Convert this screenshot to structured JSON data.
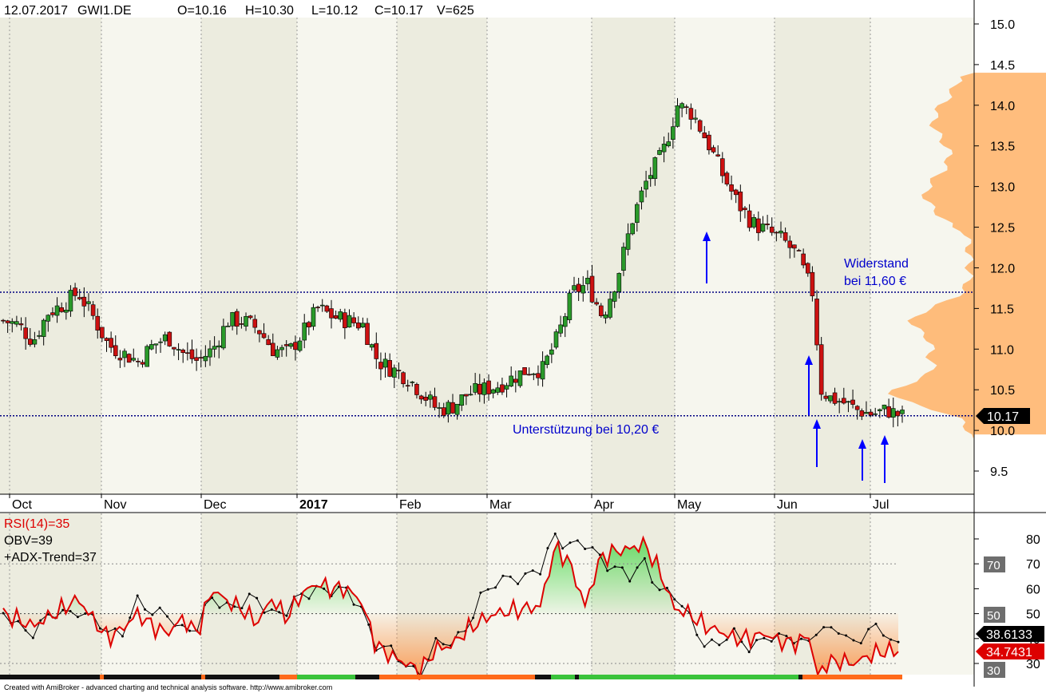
{
  "header": {
    "date": "12.07.2017",
    "symbol": "GWI1.DE",
    "open": "O=10.16",
    "high": "H=10.30",
    "low": "L=10.12",
    "close": "C=10.17",
    "volume": "V=625"
  },
  "last_price_badge": "10.17",
  "annotations": {
    "resistance_line1": "Widerstand",
    "resistance_line2": "bei 11,60 €",
    "support": "Unterstützung bei 10,20 €"
  },
  "indicators": {
    "rsi_label": "RSI(14)=35",
    "obv_label": "OBV=39",
    "adx_label": "+ADX-Trend=37",
    "badge_obv": "38.6133",
    "badge_rsi": "34.7431",
    "level_70": "70",
    "level_50": "50",
    "level_30": "30"
  },
  "footer": "Created with AmiBroker - advanced charting and technical analysis software. http://www.amibroker.com",
  "colors": {
    "up_candle": "#2a9a2a",
    "down_candle": "#cc1111",
    "rsi_line": "#dd0000",
    "obv_line": "#000000",
    "volume_profile": "#ffb266",
    "guide_line": "#000080",
    "annotation": "#0000cc"
  },
  "chart_data": [
    {
      "type": "candlestick",
      "y_axis_ticks": [
        "15.0",
        "14.5",
        "14.0",
        "13.5",
        "13.0",
        "12.5",
        "12.0",
        "11.5",
        "11.0",
        "10.5",
        "10.0",
        "9.5"
      ],
      "ylim": [
        9.2,
        15.3
      ],
      "x_tick_labels": [
        "Oct",
        "Nov",
        "Dec",
        "2017",
        "Feb",
        "Mar",
        "Apr",
        "May",
        "Jun",
        "Jul"
      ],
      "reference_lines": [
        11.7,
        10.18
      ],
      "close_path": [
        [
          0,
          11.35
        ],
        [
          5,
          11.3
        ],
        [
          10,
          11.1
        ],
        [
          15,
          11.45
        ],
        [
          20,
          11.55
        ],
        [
          25,
          11.7
        ],
        [
          30,
          11.4
        ],
        [
          35,
          11.05
        ],
        [
          40,
          10.95
        ],
        [
          45,
          10.85
        ],
        [
          50,
          11.05
        ],
        [
          55,
          11.15
        ],
        [
          60,
          10.95
        ],
        [
          65,
          10.85
        ],
        [
          70,
          11.0
        ],
        [
          75,
          11.35
        ],
        [
          80,
          11.35
        ],
        [
          85,
          11.25
        ],
        [
          90,
          11.0
        ],
        [
          95,
          10.95
        ],
        [
          100,
          11.2
        ],
        [
          105,
          11.5
        ],
        [
          110,
          11.4
        ],
        [
          115,
          11.35
        ],
        [
          120,
          11.3
        ],
        [
          125,
          10.85
        ],
        [
          130,
          10.75
        ],
        [
          135,
          10.65
        ],
        [
          140,
          10.45
        ],
        [
          145,
          10.25
        ],
        [
          150,
          10.3
        ],
        [
          155,
          10.45
        ],
        [
          160,
          10.5
        ],
        [
          165,
          10.55
        ],
        [
          170,
          10.65
        ],
        [
          175,
          10.75
        ],
        [
          180,
          10.75
        ],
        [
          185,
          11.15
        ],
        [
          190,
          11.7
        ],
        [
          195,
          11.8
        ],
        [
          200,
          11.4
        ],
        [
          205,
          11.9
        ],
        [
          210,
          12.6
        ],
        [
          215,
          13.1
        ],
        [
          220,
          13.4
        ],
        [
          225,
          14.0
        ],
        [
          230,
          13.9
        ],
        [
          235,
          13.55
        ],
        [
          240,
          13.15
        ],
        [
          245,
          12.8
        ],
        [
          250,
          12.55
        ],
        [
          255,
          12.45
        ],
        [
          260,
          12.35
        ],
        [
          265,
          12.15
        ],
        [
          270,
          11.7
        ],
        [
          273,
          10.5
        ],
        [
          276,
          10.4
        ],
        [
          280,
          10.35
        ],
        [
          285,
          10.25
        ],
        [
          290,
          10.2
        ],
        [
          295,
          10.25
        ],
        [
          300,
          10.17
        ]
      ],
      "annotations": [
        "Widerstand bei 11,60 €",
        "Unterstützung bei 10,20 €"
      ]
    },
    {
      "type": "line",
      "y_axis_ticks": [
        "80",
        "70",
        "60",
        "50",
        "40",
        "30"
      ],
      "ylim": [
        23,
        88
      ],
      "reference_levels": [
        70,
        50,
        30
      ],
      "series": [
        {
          "name": "RSI(14)",
          "values_path": [
            [
              0,
              50
            ],
            [
              10,
              45
            ],
            [
              20,
              52
            ],
            [
              25,
              56
            ],
            [
              30,
              48
            ],
            [
              35,
              40
            ],
            [
              40,
              44
            ],
            [
              45,
              50
            ],
            [
              50,
              45
            ],
            [
              55,
              42
            ],
            [
              60,
              48
            ],
            [
              65,
              42
            ],
            [
              70,
              60
            ],
            [
              75,
              55
            ],
            [
              80,
              52
            ],
            [
              85,
              46
            ],
            [
              90,
              56
            ],
            [
              95,
              48
            ],
            [
              100,
              58
            ],
            [
              105,
              62
            ],
            [
              110,
              60
            ],
            [
              115,
              60
            ],
            [
              120,
              55
            ],
            [
              125,
              37
            ],
            [
              130,
              33
            ],
            [
              135,
              30
            ],
            [
              140,
              27
            ],
            [
              145,
              36
            ],
            [
              150,
              37
            ],
            [
              155,
              43
            ],
            [
              160,
              47
            ],
            [
              165,
              50
            ],
            [
              170,
              51
            ],
            [
              175,
              52
            ],
            [
              180,
              53
            ],
            [
              185,
              77
            ],
            [
              190,
              70
            ],
            [
              195,
              53
            ],
            [
              200,
              72
            ],
            [
              205,
              75
            ],
            [
              210,
              76
            ],
            [
              215,
              78
            ],
            [
              220,
              67
            ],
            [
              225,
              52
            ],
            [
              230,
              50
            ],
            [
              235,
              45
            ],
            [
              240,
              43
            ],
            [
              245,
              40
            ],
            [
              250,
              40
            ],
            [
              255,
              42
            ],
            [
              260,
              39
            ],
            [
              265,
              38
            ],
            [
              270,
              41
            ],
            [
              273,
              25
            ],
            [
              276,
              30
            ],
            [
              280,
              31
            ],
            [
              285,
              30
            ],
            [
              290,
              33
            ],
            [
              295,
              35
            ],
            [
              300,
              34.74
            ]
          ]
        },
        {
          "name": "OBV",
          "values_path": [
            [
              0,
              48
            ],
            [
              10,
              44
            ],
            [
              20,
              50
            ],
            [
              25,
              53
            ],
            [
              30,
              47
            ],
            [
              35,
              41
            ],
            [
              40,
              45
            ],
            [
              45,
              55
            ],
            [
              50,
              48
            ],
            [
              55,
              52
            ],
            [
              60,
              44
            ],
            [
              65,
              42
            ],
            [
              70,
              58
            ],
            [
              75,
              54
            ],
            [
              80,
              52
            ],
            [
              85,
              56
            ],
            [
              90,
              52
            ],
            [
              95,
              50
            ],
            [
              100,
              56
            ],
            [
              105,
              62
            ],
            [
              110,
              59
            ],
            [
              115,
              57
            ],
            [
              120,
              54
            ],
            [
              125,
              38
            ],
            [
              130,
              33
            ],
            [
              135,
              30
            ],
            [
              140,
              28
            ],
            [
              145,
              36
            ],
            [
              150,
              38
            ],
            [
              155,
              46
            ],
            [
              160,
              55
            ],
            [
              165,
              61
            ],
            [
              170,
              67
            ],
            [
              175,
              64
            ],
            [
              180,
              66
            ],
            [
              185,
              83
            ],
            [
              190,
              78
            ],
            [
              195,
              76
            ],
            [
              200,
              73
            ],
            [
              205,
              70
            ],
            [
              210,
              63
            ],
            [
              215,
              70
            ],
            [
              220,
              62
            ],
            [
              225,
              56
            ],
            [
              230,
              47
            ],
            [
              235,
              40
            ],
            [
              240,
              38
            ],
            [
              245,
              40
            ],
            [
              250,
              38
            ],
            [
              255,
              41
            ],
            [
              260,
              38
            ],
            [
              265,
              41
            ],
            [
              270,
              40
            ],
            [
              273,
              44
            ],
            [
              276,
              40
            ],
            [
              280,
              44
            ],
            [
              285,
              40
            ],
            [
              290,
              42
            ],
            [
              295,
              42
            ],
            [
              300,
              38.61
            ]
          ]
        }
      ]
    }
  ]
}
